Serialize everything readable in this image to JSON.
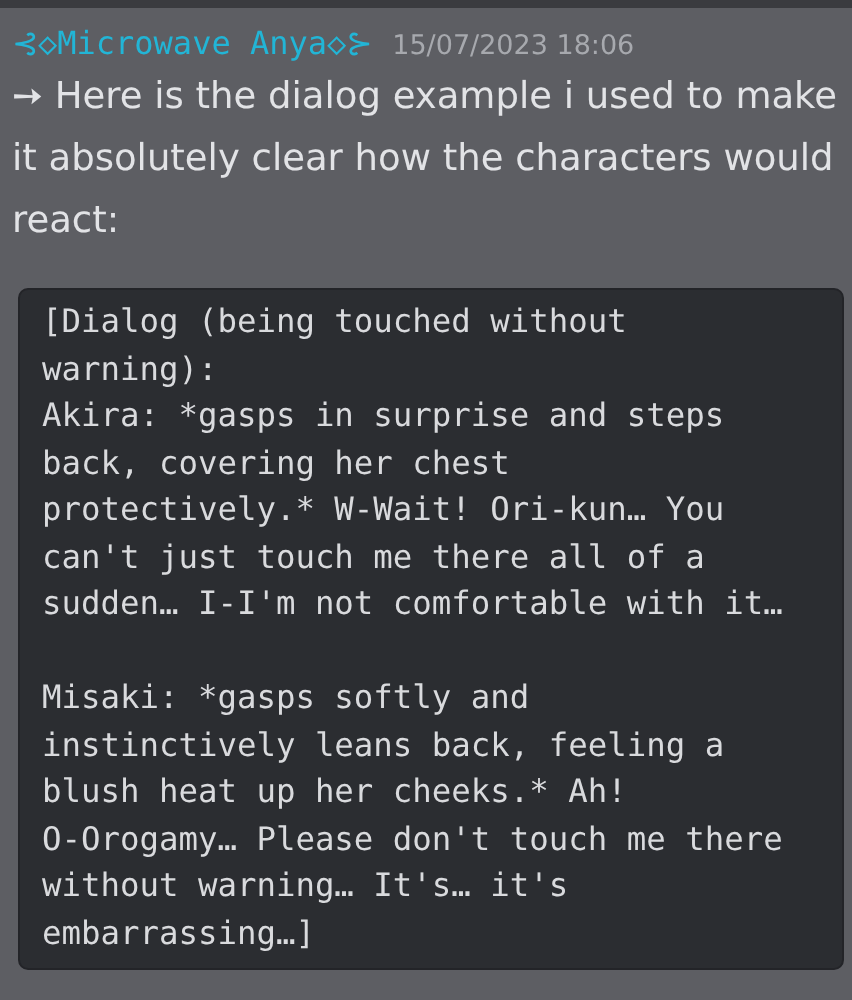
{
  "message": {
    "author": "⊰◇Microwave Anya◇⊱",
    "timestamp": "15/07/2023 18:06",
    "text": "➙ Here is the dialog example i used to make it absolutely clear how the characters would react:",
    "code_block": "[Dialog (being touched without\nwarning):\nAkira: *gasps in surprise and steps\nback, covering her chest\nprotectively.* W-Wait! Ori-kun… You\ncan't just touch me there all of a\nsudden… I-I'm not comfortable with it…\n\nMisaki: *gasps softly and\ninstinctively leans back, feeling a\nblush heat up her cheeks.* Ah!\nO-Orogamy… Please don't touch me there\nwithout warning… It's… it's\nembarrassing…]"
  }
}
